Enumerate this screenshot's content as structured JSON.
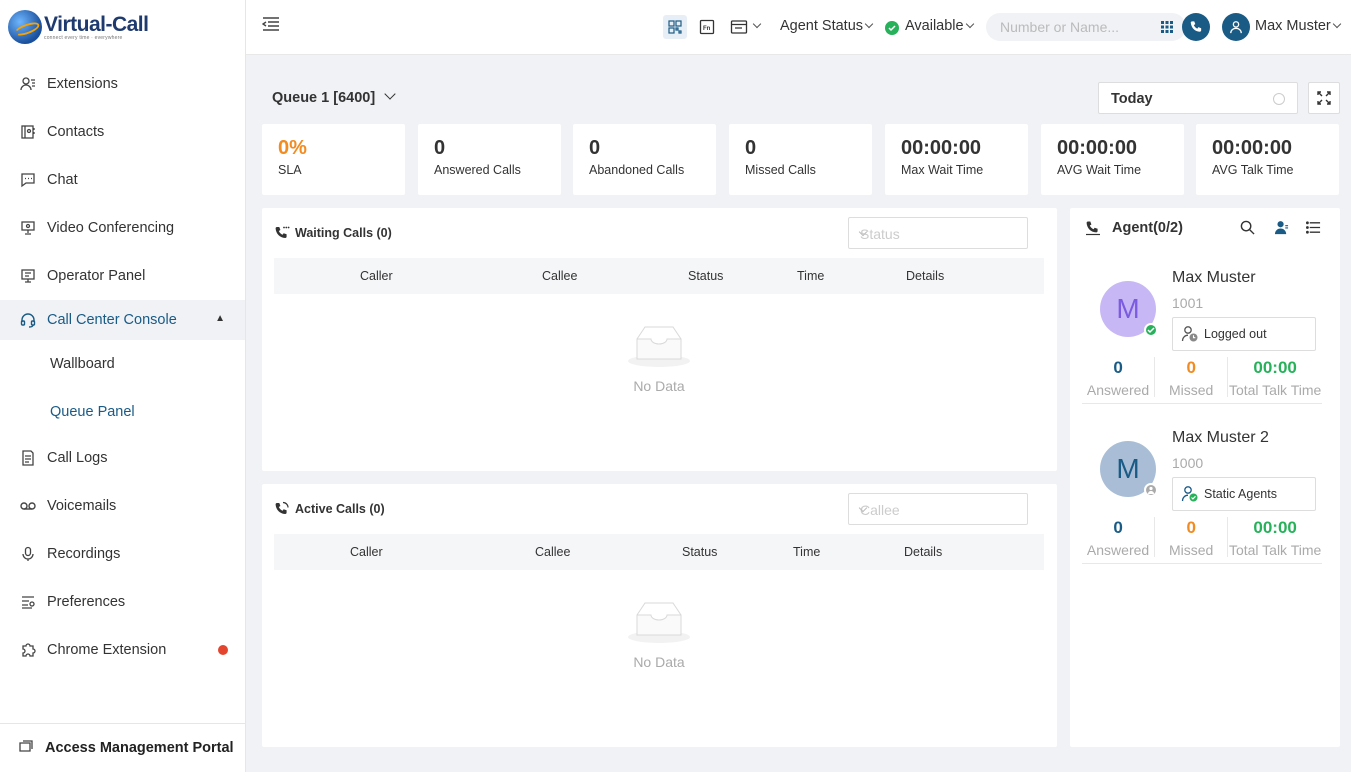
{
  "brand": {
    "name": "Virtual-Call",
    "tagline": "connect every time · everywhere"
  },
  "sidebar": {
    "items": [
      {
        "label": "Extensions",
        "icon": "extensions-icon"
      },
      {
        "label": "Contacts",
        "icon": "contacts-icon"
      },
      {
        "label": "Chat",
        "icon": "chat-icon"
      },
      {
        "label": "Video Conferencing",
        "icon": "video-icon"
      },
      {
        "label": "Operator Panel",
        "icon": "operator-icon"
      },
      {
        "label": "Call Center Console",
        "icon": "headset-icon",
        "expanded": true
      },
      {
        "label": "Call Logs",
        "icon": "call-logs-icon"
      },
      {
        "label": "Voicemails",
        "icon": "voicemail-icon"
      },
      {
        "label": "Recordings",
        "icon": "microphone-icon"
      },
      {
        "label": "Preferences",
        "icon": "preferences-icon"
      },
      {
        "label": "Chrome Extension",
        "icon": "puzzle-icon",
        "notification": true
      }
    ],
    "subitems": [
      {
        "label": "Wallboard"
      },
      {
        "label": "Queue Panel",
        "active": true
      }
    ],
    "portal": "Access Management Portal"
  },
  "topbar": {
    "agent_status": "Agent Status",
    "availability": "Available",
    "search_placeholder": "Number or Name...",
    "user": "Max Muster"
  },
  "queue": {
    "title": "Queue 1 [6400]",
    "period": "Today"
  },
  "stats": [
    {
      "value": "0%",
      "label": "SLA",
      "color": "#f28b20"
    },
    {
      "value": "0",
      "label": "Answered Calls"
    },
    {
      "value": "0",
      "label": "Abandoned Calls"
    },
    {
      "value": "0",
      "label": "Missed Calls"
    },
    {
      "value": "00:00:00",
      "label": "Max Wait Time"
    },
    {
      "value": "00:00:00",
      "label": "AVG Wait Time"
    },
    {
      "value": "00:00:00",
      "label": "AVG Talk Time"
    }
  ],
  "waiting": {
    "title": "Waiting Calls (0)",
    "filter_placeholder": "Status",
    "columns": [
      "Caller",
      "Callee",
      "Status",
      "Time",
      "Details"
    ],
    "empty": "No Data"
  },
  "active": {
    "title": "Active Calls (0)",
    "filter_placeholder": "Callee",
    "columns": [
      "Caller",
      "Callee",
      "Status",
      "Time",
      "Details"
    ],
    "empty": "No Data"
  },
  "agents": {
    "title": "Agent(0/2)",
    "list": [
      {
        "initial": "M",
        "name": "Max Muster",
        "ext": "1001",
        "status": "Logged out",
        "answered": "0",
        "missed": "0",
        "talk": "00:00",
        "avatar_color": "#c7b8f5",
        "initial_color": "#7b5ce0"
      },
      {
        "initial": "M",
        "name": "Max Muster 2",
        "ext": "1000",
        "status": "Static Agents",
        "answered": "0",
        "missed": "0",
        "talk": "00:00",
        "avatar_color": "#a9bed6",
        "initial_color": "#1a5b86"
      }
    ],
    "labels": {
      "answered": "Answered",
      "missed": "Missed",
      "talk": "Total Talk Time"
    }
  }
}
